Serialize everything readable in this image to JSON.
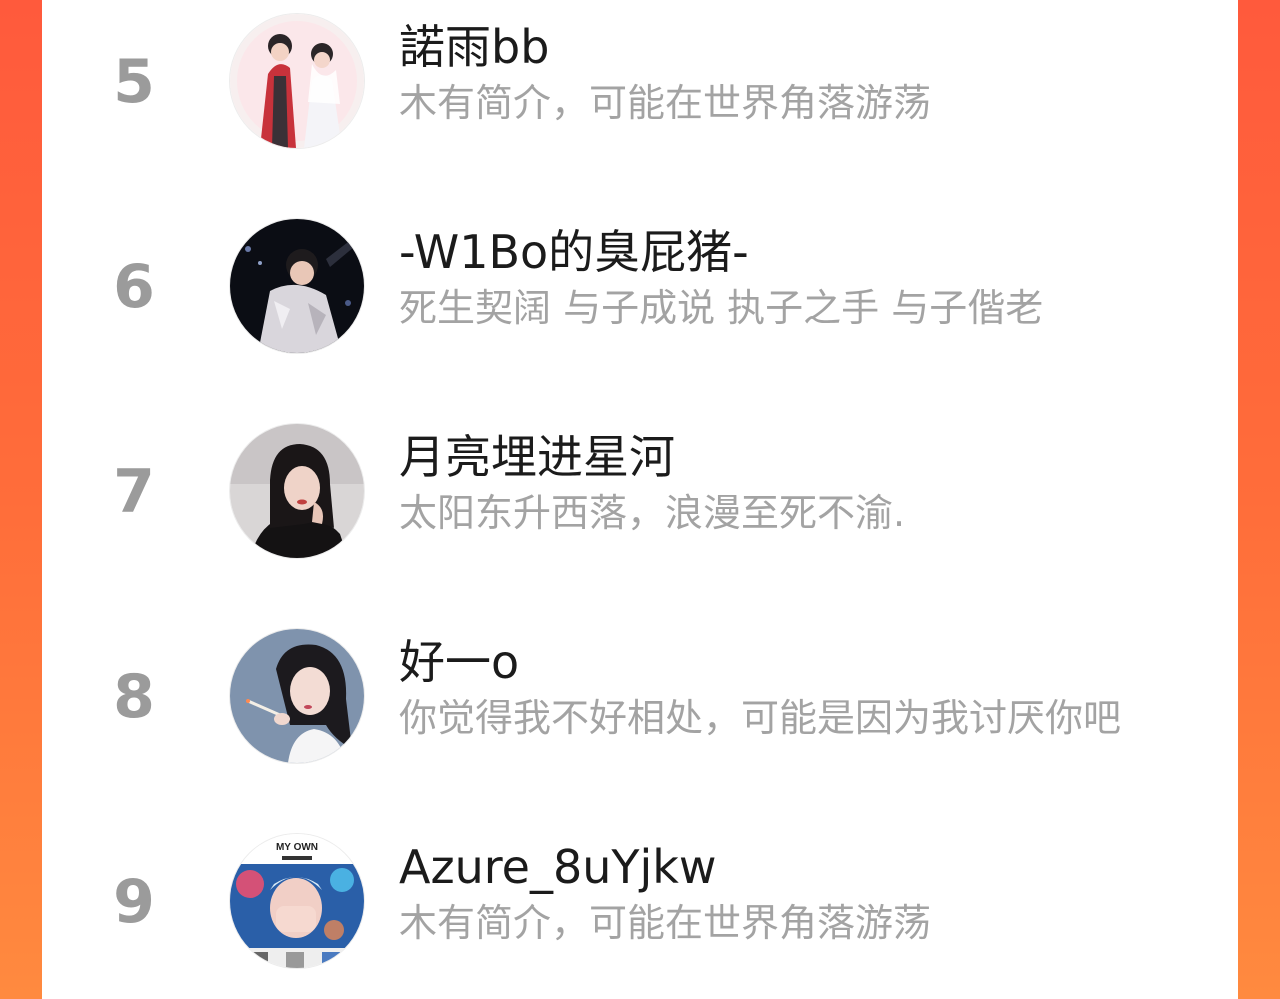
{
  "ranking": {
    "items": [
      {
        "rank": "5",
        "name": "諾雨bb",
        "bio": "木有简介，可能在世界角落游荡",
        "avatar": "couple-illustration-avatar"
      },
      {
        "rank": "6",
        "name": "-W1Bo的臭屁猪-",
        "bio": "死生契阔 与子成说 执子之手 与子偕老",
        "avatar": "performer-photo-avatar"
      },
      {
        "rank": "7",
        "name": "月亮埋进星河",
        "bio": "太阳东升西落，浪漫至死不渝.",
        "avatar": "woman-photo-avatar"
      },
      {
        "rank": "8",
        "name": "好一o",
        "bio": "你觉得我不好相处，可能是因为我讨厌你吧",
        "avatar": "girl-illustration-avatar"
      },
      {
        "rank": "9",
        "name": "Azure_8uYjkw",
        "bio": "木有简介，可能在世界角落游荡",
        "avatar": "my-own-poster-avatar"
      }
    ]
  },
  "avatar_texts": {
    "poster_title": "MY OWN"
  },
  "colors": {
    "background_gradient_top": "#ff5a3c",
    "background_gradient_bottom": "#ff8a3f",
    "rank_color": "#9b9b9b",
    "name_color": "#1b1b1b",
    "bio_color": "#a3a3a3"
  }
}
